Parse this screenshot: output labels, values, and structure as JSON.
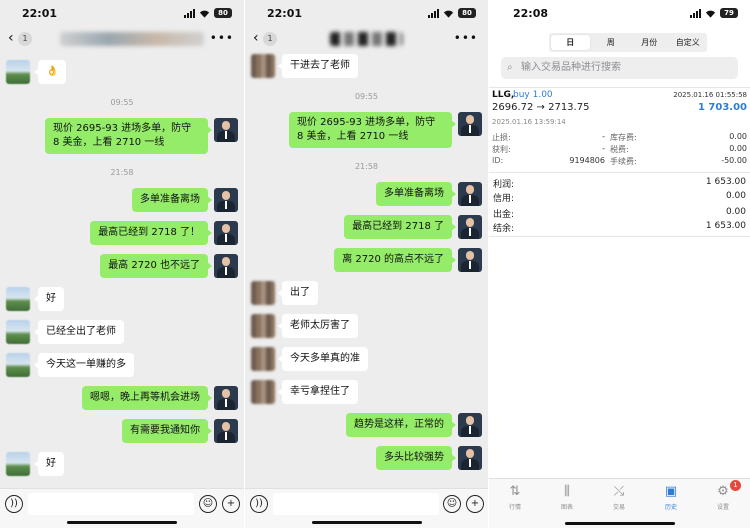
{
  "chat1": {
    "time": "22:01",
    "battery": "80",
    "unread": "1",
    "timestamps": [
      "09:55",
      "21:58"
    ],
    "messages": [
      {
        "side": "left",
        "text": "👌"
      },
      {
        "side": "right",
        "text": "现价 2695-93 进场多单，防守 8 美金，上看 2710 一线"
      },
      {
        "side": "right",
        "text": "多单准备离场"
      },
      {
        "side": "right",
        "text": "最高已经到 2718 了！"
      },
      {
        "side": "right",
        "text": "最高 2720 也不远了"
      },
      {
        "side": "left",
        "text": "好"
      },
      {
        "side": "left",
        "text": "已经全出了老师"
      },
      {
        "side": "left",
        "text": "今天这一单赚的多"
      },
      {
        "side": "right",
        "text": "嗯嗯，晚上再等机会进场"
      },
      {
        "side": "right",
        "text": "有需要我通知你"
      },
      {
        "side": "left",
        "text": "好"
      }
    ]
  },
  "chat2": {
    "time": "22:01",
    "battery": "80",
    "unread": "1",
    "timestamps": [
      "09:55",
      "21:58"
    ],
    "messages": [
      {
        "side": "left",
        "text": "干进去了老师"
      },
      {
        "side": "right",
        "text": "现价 2695-93 进场多单，防守 8 美金，上看 2710 一线"
      },
      {
        "side": "right",
        "text": "多单准备离场"
      },
      {
        "side": "right",
        "text": "最高已经到 2718 了"
      },
      {
        "side": "right",
        "text": "离 2720 的高点不远了"
      },
      {
        "side": "left",
        "text": "出了"
      },
      {
        "side": "left",
        "text": "老师太厉害了"
      },
      {
        "side": "left",
        "text": "今天多单真的准"
      },
      {
        "side": "left",
        "text": "幸亏拿捏住了"
      },
      {
        "side": "right",
        "text": "趋势是这样，正常的"
      },
      {
        "side": "right",
        "text": "多头比较强势"
      }
    ]
  },
  "trade": {
    "time": "22:08",
    "battery": "79",
    "segments": [
      "日",
      "周",
      "月份",
      "自定义"
    ],
    "active_segment": "日",
    "search_placeholder": "输入交易品种进行搜索",
    "symbol": "LLG,",
    "side": "buy 1.00",
    "close_time": "2025.01.16 01:55:58",
    "prices": "2696.72 → 2713.75",
    "profit": "1 703.00",
    "open_time": "2025.01.16 13:59:14",
    "details_left": [
      {
        "label": "止损:",
        "value": "-"
      },
      {
        "label": "获利:",
        "value": "-"
      },
      {
        "label": "ID:",
        "value": "9194806"
      }
    ],
    "details_right": [
      {
        "label": "库存费:",
        "value": "0.00"
      },
      {
        "label": "税费:",
        "value": "0.00"
      },
      {
        "label": "手续费:",
        "value": "-50.00"
      }
    ],
    "summary": [
      {
        "label": "利润:",
        "value": "1 653.00"
      },
      {
        "label": "信用:",
        "value": "0.00"
      },
      {
        "label": "出金:",
        "value": "0.00"
      },
      {
        "label": "结余:",
        "value": "1 653.00"
      }
    ],
    "tabs": [
      {
        "label": "行情",
        "icon": "quotes-icon"
      },
      {
        "label": "图表",
        "icon": "chart-icon"
      },
      {
        "label": "交易",
        "icon": "trade-icon"
      },
      {
        "label": "历史",
        "icon": "history-icon"
      },
      {
        "label": "设置",
        "icon": "settings-icon"
      }
    ],
    "active_tab": "历史",
    "settings_badge": "1",
    "accent_color": "#2f7dd6",
    "bubble_green": "#95ec69"
  }
}
